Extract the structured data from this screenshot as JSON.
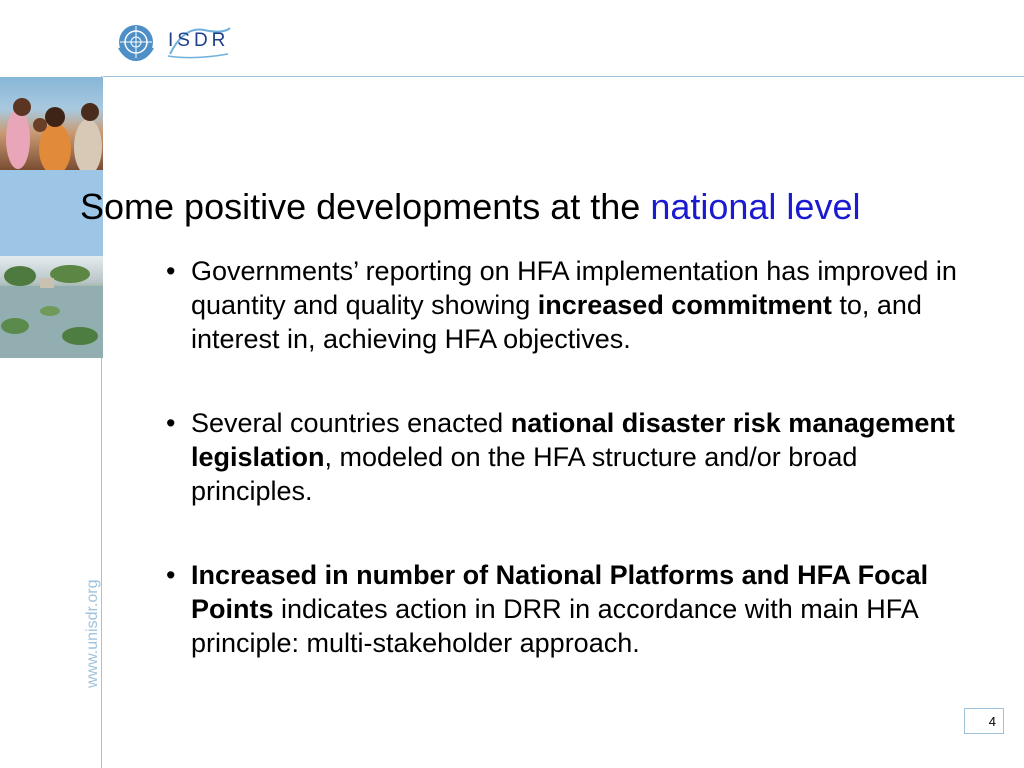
{
  "header": {
    "logo_text": "ISDR"
  },
  "sidebar": {
    "url": "www.unisdr.org"
  },
  "title": {
    "main": "Some positive developments at the ",
    "accent": "national level",
    "accent_color": "#1a1ad0"
  },
  "bullets": [
    {
      "marker": "•",
      "parts": [
        {
          "text": "Governments’ reporting on HFA implementation has improved in quantity and quality showing ",
          "bold": false
        },
        {
          "text": "increased commitment",
          "bold": true
        },
        {
          "text": " to, and interest in, achieving HFA objectives.",
          "bold": false
        }
      ]
    },
    {
      "marker": "•",
      "parts": [
        {
          "text": "Several countries enacted ",
          "bold": false
        },
        {
          "text": "national disaster risk management legislation",
          "bold": true
        },
        {
          "text": ", modeled on the HFA structure and/or broad principles.",
          "bold": false
        }
      ]
    },
    {
      "marker": "•",
      "parts": [
        {
          "text": "Increased in number of National Platforms and HFA Focal Points",
          "bold": true
        },
        {
          "text": " indicates action in DRR in accordance with main HFA principle: multi-stakeholder approach.",
          "bold": false
        }
      ]
    }
  ],
  "footer": {
    "page_number": "4"
  },
  "colors": {
    "rule": "#9fc3dc",
    "logo": "#1f3f8a"
  }
}
